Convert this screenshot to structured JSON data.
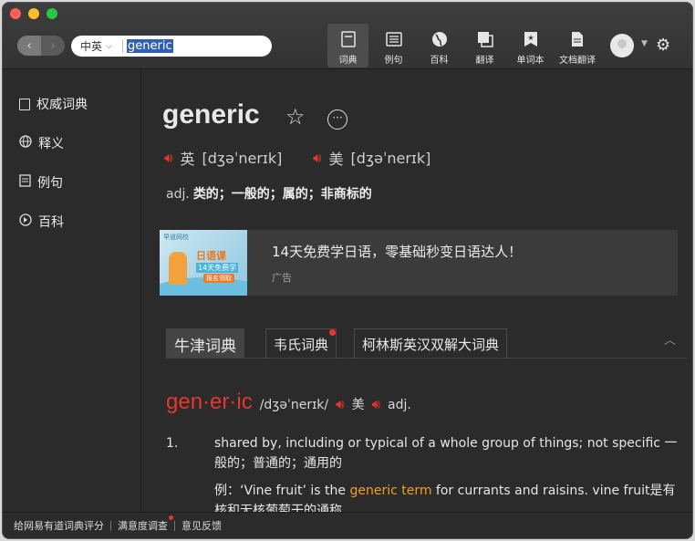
{
  "toolbar": {
    "lang_selector": "中英",
    "search_value": "generic",
    "tools": [
      {
        "label": "词典",
        "icon": "dict-icon"
      },
      {
        "label": "例句",
        "icon": "sentences-icon"
      },
      {
        "label": "百科",
        "icon": "globe-icon"
      },
      {
        "label": "翻译",
        "icon": "translate-icon"
      },
      {
        "label": "单词本",
        "icon": "wordbook-icon"
      },
      {
        "label": "文档翻译",
        "icon": "document-icon"
      }
    ]
  },
  "sidebar": {
    "items": [
      {
        "label": "权威词典",
        "icon": "book-icon"
      },
      {
        "label": "释义",
        "icon": "globe-icon"
      },
      {
        "label": "例句",
        "icon": "sentences-icon"
      },
      {
        "label": "百科",
        "icon": "compass-icon"
      }
    ]
  },
  "word": {
    "headword": "generic",
    "uk_label": "英",
    "uk_ipa": "[dʒəˈnerɪk]",
    "us_label": "美",
    "us_ipa": "[dʒəˈnerɪk]",
    "pos": "adj.",
    "meaning": "类的；一般的；属的；非商标的"
  },
  "ad": {
    "title": "14天免费学日语，零基础秒变日语达人！",
    "label": "广告",
    "image_brand": "早道网校",
    "image_title": "日语课",
    "image_sub": "14天免费学",
    "image_button": "报名领取"
  },
  "dict_tabs": [
    {
      "label": "牛津词典"
    },
    {
      "label": "韦氏词典"
    },
    {
      "label": "柯林斯英汉双解大词典"
    }
  ],
  "entry": {
    "word": "gen·er·ic",
    "ipa": "/dʒəˈnerɪk/",
    "us_label": "美",
    "pos": "adj.",
    "sense_num": "1.",
    "sense_text": "shared by, including or typical of a whole group of things; not specific 一般的；普通的；通用的",
    "example_prefix": "例：",
    "example_before": "‘Vine fruit’ is the ",
    "example_highlight": "generic term",
    "example_after": " for currants and raisins. vine fruit是有核和无核葡萄干的通称"
  },
  "footer": {
    "rate": "给网易有道词典评分",
    "survey": "满意度调查",
    "feedback": "意见反馈"
  },
  "colors": {
    "accent_red": "#e8352e",
    "highlight_orange": "#f0a020",
    "background": "#2b2b2b"
  }
}
